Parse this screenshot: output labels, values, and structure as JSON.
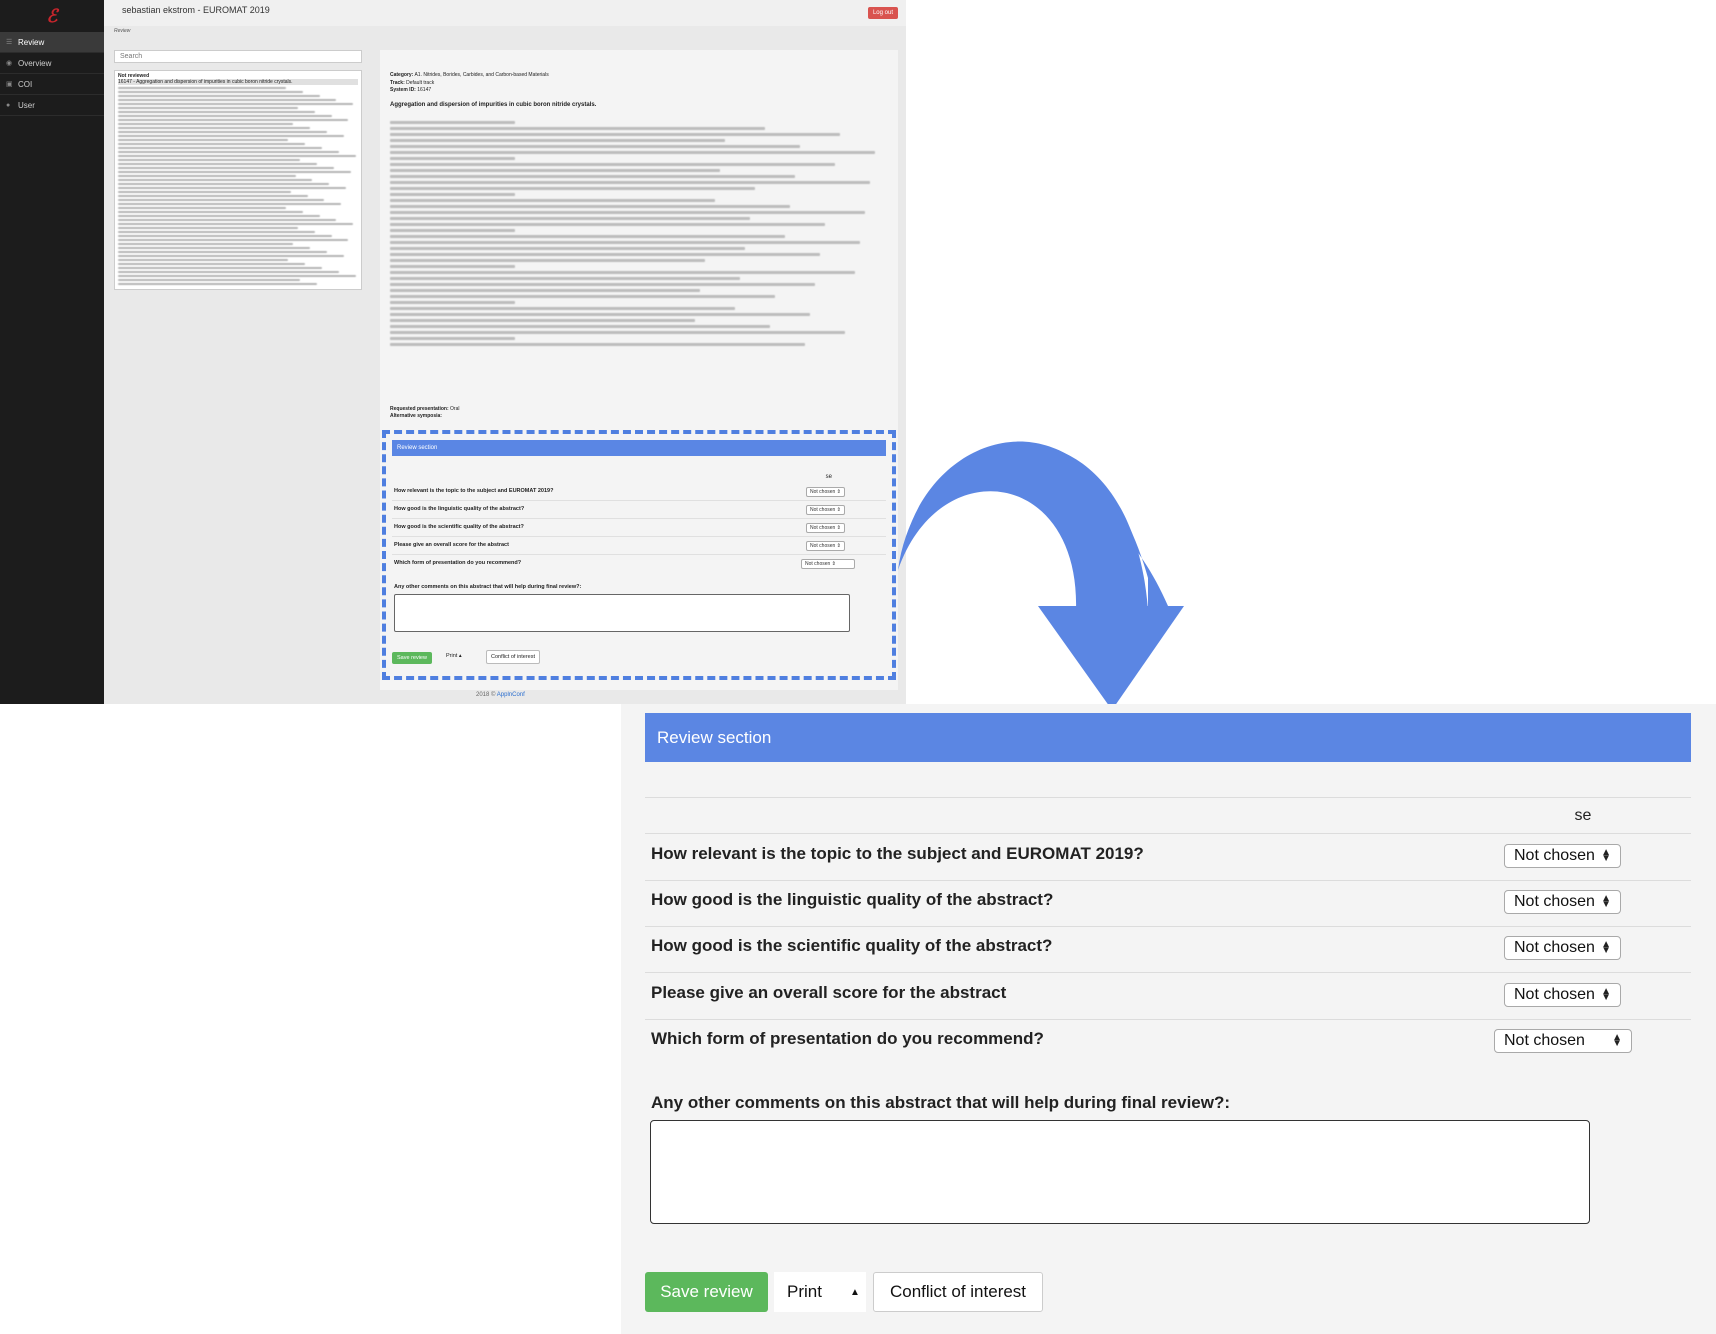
{
  "app": {
    "window_title": "sebastian ekstrom - EUROMAT 2019",
    "logout_label": "Log out",
    "breadcrumb": "Review",
    "footer_year": "2018 ©",
    "footer_link": "ApplnConf"
  },
  "sidebar": {
    "logo": "ℰ",
    "items": [
      {
        "label": "Review",
        "icon": "list-icon"
      },
      {
        "label": "Overview",
        "icon": "eye-icon"
      },
      {
        "label": "COI",
        "icon": "lock-icon"
      },
      {
        "label": "User",
        "icon": "user-icon"
      }
    ]
  },
  "abstract_list": {
    "search_placeholder": "Search",
    "group_header": "Not reviewed",
    "selected_item": "16147 - Aggregation and dispersion of impurities in cubic boron nitride crystals."
  },
  "abstract_detail": {
    "category_label": "Category:",
    "category_value": "A1. Nitrides, Borides, Carbides, and Carbon-based Materials",
    "track_label": "Track:",
    "track_value": "Default track",
    "system_id_label": "System ID:",
    "system_id_value": "16147",
    "title": "Aggregation and dispersion of impurities in cubic boron nitride crystals.",
    "requested_presentation_label": "Requested presentation:",
    "requested_presentation_value": "Oral",
    "alternative_symposia_label": "Alternative symposia:"
  },
  "review": {
    "header": "Review section",
    "column_label": "se",
    "questions": [
      {
        "label": "How relevant is the topic to the subject and EUROMAT 2019?",
        "value": "Not chosen"
      },
      {
        "label": "How good is the linguistic quality of the abstract?",
        "value": "Not chosen"
      },
      {
        "label": "How good is the scientific quality of the abstract?",
        "value": "Not chosen"
      },
      {
        "label": "Please give an overall score for the abstract",
        "value": "Not chosen"
      },
      {
        "label": "Which form of presentation do you recommend?",
        "value": "Not chosen"
      }
    ],
    "comments_label": "Any other comments on this abstract that will help during final review?:",
    "comments_value": "",
    "save_label": "Save review",
    "print_label": "Print",
    "coi_label": "Conflict of interest"
  },
  "colors": {
    "accent_blue": "#5b86e3",
    "save_green": "#5cb85c",
    "logout_red": "#d9534f",
    "sidebar_dark": "#1c1c1c"
  }
}
